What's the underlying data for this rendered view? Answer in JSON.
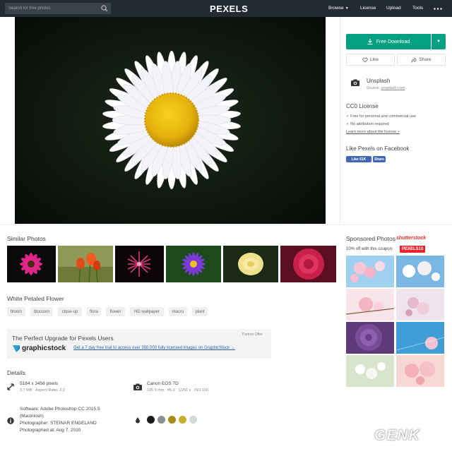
{
  "header": {
    "search_placeholder": "Search for free photos",
    "logo": "PEXELS",
    "nav": {
      "browse": "Browse",
      "license": "License",
      "upload": "Upload",
      "tools": "Tools"
    }
  },
  "actions": {
    "download_label": "Free Download",
    "like_label": "Like",
    "share_label": "Share"
  },
  "source": {
    "name": "Unsplash",
    "prefix": "Source:",
    "link": "unsplash.com"
  },
  "license": {
    "title": "CC0 License",
    "line1": "✓ Free for personal and commercial use",
    "line2": "✓ No attribution required",
    "link": "Learn more about the license »"
  },
  "facebook": {
    "title": "Like Pexels on Facebook",
    "like_label": "Like 61K",
    "share_label": "Share"
  },
  "similar": {
    "title": "Similar Photos"
  },
  "tags": {
    "title": "White Petaled Flower",
    "items": [
      "bloom",
      "blossom",
      "close-up",
      "flora",
      "flower",
      "HD wallpaper",
      "macro",
      "plant"
    ]
  },
  "partner": {
    "label": "Partner Offer",
    "headline": "The Perfect Upgrade for Pexels Users",
    "brand": "graphicstock",
    "link": "Get a 7 day free trial to access over 350,000 fully licensed images on GraphicStock →"
  },
  "details": {
    "title": "Details",
    "dimensions": "5184 x 3456 pixels",
    "size": "3.7 MB",
    "aspect": "Aspect Ratio: 3:2",
    "camera": "Canon EOS 7D",
    "focal": "105.0 mm",
    "aperture": "f/5.0",
    "shutter": "1/250 s",
    "iso": "ISO 100",
    "software_line1": "Software: Adobe Photoshop CC 2015.5",
    "software_line2": "(Macintosh)",
    "photographer": "Photographer: STEINAR ENGELAND",
    "date": "Photographed at: Aug 7, 2010",
    "palette": [
      "#1a1a1a",
      "#8f8f8f",
      "#a88c19",
      "#c9ad2b",
      "#d4d8d8"
    ]
  },
  "sponsored": {
    "title": "Sponsored Photos",
    "brand": "shutterstock",
    "coupon_text": "10% off with this coupon:",
    "coupon_code": "PEXELS10",
    "image_id": "399653246"
  },
  "watermark": "GENK"
}
